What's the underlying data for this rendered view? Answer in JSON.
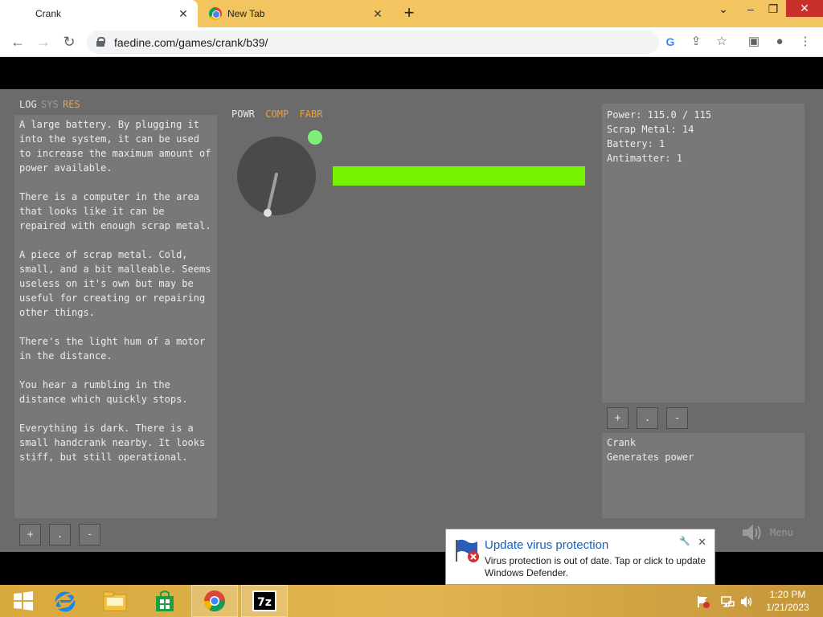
{
  "browser": {
    "tabs": [
      {
        "title": "Crank",
        "active": true
      },
      {
        "title": "New Tab",
        "active": false
      }
    ],
    "url": "faedine.com/games/crank/b39/"
  },
  "game": {
    "left_tabs": [
      "LOG",
      "SYS",
      "RES"
    ],
    "log": [
      "A large battery. By plugging it into the system, it can be used to increase the maximum amount of power available.",
      "There is a computer in the area that looks like it can be repaired with enough scrap metal.",
      "A piece of scrap metal. Cold, small, and a bit malleable. Seems useless on it's own but may be useful for creating or repairing other things.",
      "There's the light hum of a motor in the distance.",
      "You hear a rumbling in the distance which quickly stops.",
      "Everything is dark. There is a small handcrank nearby. It looks stiff, but still operational."
    ],
    "buttons": {
      "plus": "+",
      "dot": ".",
      "minus": "-"
    },
    "mid_tabs": [
      "POWR",
      "COMP",
      "FABR"
    ],
    "power_fraction": 1.0,
    "resources": [
      "Power: 115.0 / 115",
      "Scrap Metal: 14",
      "Battery: 1",
      "Antimatter: 1"
    ],
    "description": {
      "name": "Crank",
      "text": "Generates power"
    },
    "menu_label": "Menu",
    "colors": {
      "accent": "#f0a030",
      "power_bar": "#77f200",
      "indicator": "#7ef07a"
    }
  },
  "notification": {
    "title": "Update virus protection",
    "body": "Virus protection is out of date. Tap or click to update Windows Defender."
  },
  "taskbar": {
    "time": "1:20 PM",
    "date": "1/21/2023"
  }
}
